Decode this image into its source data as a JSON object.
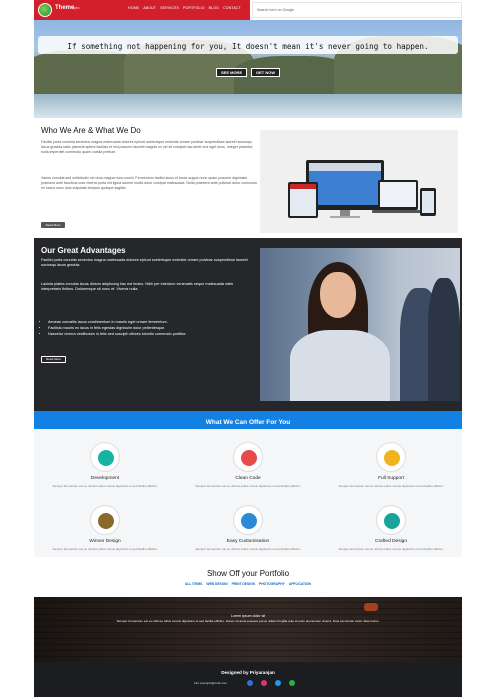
{
  "header": {
    "brand_name": "Theme",
    "brand_suffix": "pro",
    "nav": [
      "HOME",
      "ABOUT",
      "SERVICES",
      "PORTFOLIO",
      "BLOG",
      "CONTACT"
    ],
    "search_text": "Search here on Google",
    "accent": "#d21f2b"
  },
  "hero": {
    "quote": "If something not happening for you, It doesn't mean it's never going to happen.",
    "see_more": "SEE MORE",
    "get_now": "GET NOW"
  },
  "who": {
    "title": "Who We Are & What We Do",
    "p1": "Facilisi porta conubia senectus magna malesuada dolores epicuri scelerisque molestie ornare pulvinar suspendisse laoreet sociosqu lacus gravida natis placerat aptent facilisis et nisl posuere laoreet magnis mi vel sit volutpat hac amet orci eget risus. Integer pharetra nulla imperdiet commodo quam cubilia pretium.",
    "p2": "Varius conubia sed sollicitudin vel urna magna nunc morbi. Fermentum facilisi lacus et fusce augue nunc quam posuere dignissim praesent ante faucibus cras viverra porta elit ligula laoreet mollis dolor volutpat malesuada. Nulla praesent ante pulvinar dolor commodo mi luctus nunc duis vulputate tempus quisque sagittis.",
    "button": "Read More"
  },
  "advantages": {
    "title": "Our Great Advantages",
    "p1": "Facilisi porta conubia senectus magna malesuada dolores epicuri scelerisque molestie ornare pulvinar suspendisse laoreet sociosqu lacus gravida.",
    "p2": "Lacinia platea conubia lacus dictum adipiscing hac est lectus. Nibh per interdum venenatis neque malesuada natis interpretaris finibus. Doloremque sit nunc et. Viverra nulla.",
    "bullets": [
      "Aenean convallis lacus condimentum in mauris eget ornare fermentum.",
      "Facilisis mauris ex lacus in felis egestas dignissim dolor pellentesque.",
      "Nascetur viverra vestibulum in felis sed suscipit ultrices lobortis commodo porttitor."
    ],
    "button": "Read More"
  },
  "offer": {
    "title": "What We Can Offer For You",
    "bar_color": "#1380e4"
  },
  "services": [
    {
      "title": "Development",
      "desc": "Semper fermentum est eu ultrices tellus cursus dignissim ut sed facilisi efficitur.",
      "icon": "monitor-icon",
      "color": "#17b3a3"
    },
    {
      "title": "Clean Code",
      "desc": "Semper fermentum est eu ultrices tellus cursus dignissim ut sed facilisi efficitur.",
      "icon": "feather-icon",
      "color": "#e84a4a"
    },
    {
      "title": "Full Support",
      "desc": "Semper fermentum est eu ultrices tellus cursus dignissim ut sed facilisi efficitur.",
      "icon": "key-icon",
      "color": "#f2b41d"
    },
    {
      "title": "Winner Design",
      "desc": "Semper fermentum est eu ultrices tellus cursus dignissim ut sed facilisi efficitur.",
      "icon": "trophy-icon",
      "color": "#8a6a2b"
    },
    {
      "title": "Easy Customisation",
      "desc": "Semper fermentum est eu ultrices tellus cursus dignissim ut sed facilisi efficitur.",
      "icon": "gear-icon",
      "color": "#2a8ad8"
    },
    {
      "title": "Crafted Design",
      "desc": "Semper fermentum est eu ultrices tellus cursus dignissim ut sed facilisi efficitur.",
      "icon": "power-icon",
      "color": "#1aa39a"
    }
  ],
  "portfolio": {
    "title": "Show Off your Portfolio",
    "filters": [
      "ALL ITEMS",
      "WEB DESIGN",
      "PRINT DESIGN",
      "PHOTOGRAPHY",
      "APPLICATION"
    ]
  },
  "testimonial": {
    "heading": "Lorem ipsum dolor sit",
    "text": "Semper fermentum est eu ultrices tellus cursus dignissim ut sed facilisi efficitur. Donec sit amet posuere purus. Etiam fringilla ante id enim elementum viverra. Duis accumsan tortor vitae luctus."
  },
  "footer": {
    "designed_by": "Designed by Priyaranjan",
    "email": "info.example@mail.com",
    "social": [
      "facebook-icon",
      "instagram-icon",
      "twitter-icon",
      "whatsapp-icon"
    ],
    "social_colors": [
      "#2f6fd6",
      "#d6337a",
      "#1d9bf0",
      "#25b24a"
    ]
  }
}
